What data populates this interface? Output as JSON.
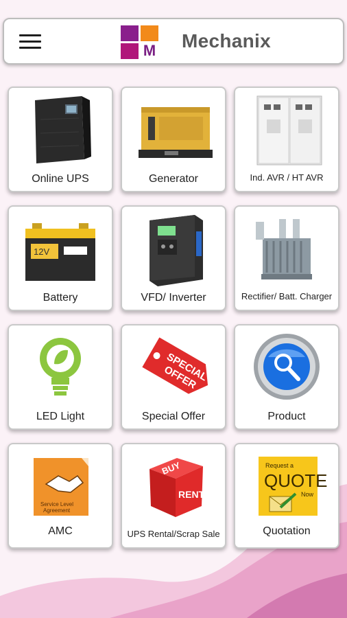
{
  "header": {
    "app_title": "Mechanix",
    "logo_letter": "M"
  },
  "tiles": [
    {
      "label": "Online UPS"
    },
    {
      "label": "Generator"
    },
    {
      "label": "Ind. AVR / HT AVR"
    },
    {
      "label": "Battery"
    },
    {
      "label": "VFD/ Inverter"
    },
    {
      "label": "Rectifier/ Batt. Charger"
    },
    {
      "label": "LED Light"
    },
    {
      "label": "Special Offer"
    },
    {
      "label": "Product"
    },
    {
      "label": "AMC"
    },
    {
      "label": "UPS Rental/Scrap Sale"
    },
    {
      "label": "Quotation"
    }
  ],
  "art": {
    "battery_voltage": "12V",
    "special_offer_tag": [
      "SPECIAL",
      "OFFER"
    ],
    "amc_caption": [
      "Service Level",
      "Agreement"
    ],
    "rent_cube": [
      "BUY",
      "RENT"
    ],
    "quote_badge": [
      "Request a",
      "QUOTE",
      "Now"
    ]
  },
  "colors": {
    "background": "#fbf2f7",
    "accent_purple": "#8a1f8c",
    "accent_orange": "#f28a1a",
    "accent_magenta": "#b0167a",
    "wave": "#e9a3c9"
  }
}
